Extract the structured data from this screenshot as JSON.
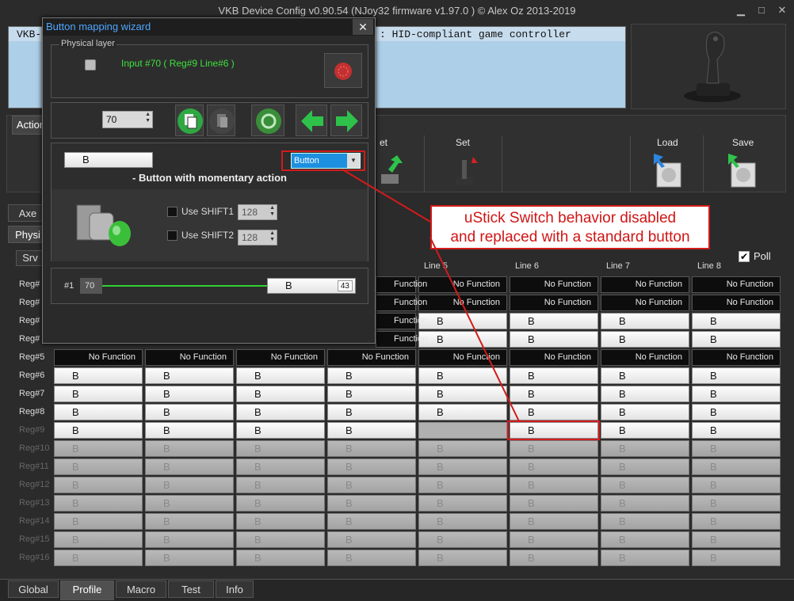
{
  "window": {
    "title": "VKB Device Config v0.90.54 (NJoy32 firmware v1.97.0  ) © Alex Oz 2013-2019",
    "minimize": "▁",
    "maximize": "□",
    "close": "✕"
  },
  "device_list": {
    "row1_left": "VKB-",
    "row1_right": ": HID-compliant game controller"
  },
  "toolbar": {
    "left_tab": "Action",
    "get_label": "et",
    "set_label": "Set",
    "load_label": "Load",
    "save_label": "Save"
  },
  "side_tabs": {
    "axes": "Axe",
    "physical": "Physi",
    "srv": "Srv"
  },
  "poll": {
    "label": "Poll",
    "checked": true
  },
  "grid": {
    "line_headers": [
      "Line 5",
      "Line 6",
      "Line 7",
      "Line 8"
    ],
    "no_function": "No Function",
    "button_letter": "B",
    "rows": [
      "Reg#",
      "Reg#",
      "Reg#",
      "Reg#",
      "Reg#5",
      "Reg#6",
      "Reg#7",
      "Reg#8",
      "Reg#9",
      "Reg#10",
      "Reg#11",
      "Reg#12",
      "Reg#13",
      "Reg#14",
      "Reg#15",
      "Reg#16"
    ],
    "partial_labels": [
      "Function",
      "Function",
      "Function",
      "Function"
    ]
  },
  "wizard": {
    "title": "Button mapping wizard",
    "close": "✕",
    "physical_layer": "Physical layer",
    "input_text": "Input #70  ( Reg#9   Line#6 )",
    "spin_value": "70",
    "button_label_value": "B",
    "type_select": "Button",
    "type_description": "- Button with momentary action",
    "shift1_label": "Use SHIFT1",
    "shift1_value": "128",
    "shift2_label": "Use SHIFT2",
    "shift2_value": "128",
    "map_index": "#1",
    "map_input": "70",
    "map_button": "B",
    "map_number": "43"
  },
  "annotation": {
    "text_line1": "uStick Switch behavior disabled",
    "text_line2": "and replaced with a standard button"
  },
  "bottom_tabs": [
    "Global",
    "Profile",
    "Macro",
    "Test",
    "Info"
  ],
  "active_tab": "Profile",
  "colors": {
    "accent": "#4ea7ff",
    "annotation": "#d21b1b",
    "input_green": "#3fe03f",
    "select_blue": "#1e90e0"
  }
}
